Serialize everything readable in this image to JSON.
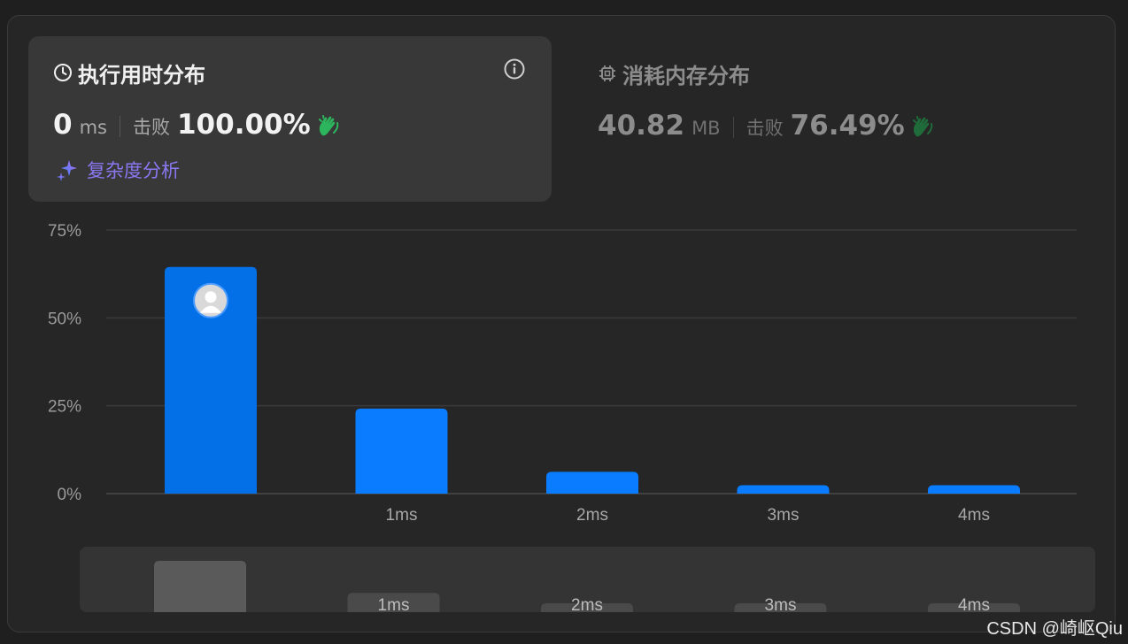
{
  "runtime": {
    "title": "执行用时分布",
    "value": "0",
    "unit": "ms",
    "beat_label": "击败",
    "beat_value": "100.00%",
    "analysis_label": "复杂度分析"
  },
  "memory": {
    "title": "消耗内存分布",
    "value": "40.82",
    "unit": "MB",
    "beat_label": "击败",
    "beat_value": "76.49%"
  },
  "chart_data": {
    "type": "bar",
    "categories": [
      "0ms",
      "1ms",
      "2ms",
      "3ms",
      "4ms"
    ],
    "category_labels": [
      "",
      "1ms",
      "2ms",
      "3ms",
      "4ms"
    ],
    "values": [
      64.5,
      24.2,
      6.2,
      2.4,
      2.4
    ],
    "highlighted_index": 0,
    "yticks": [
      "0%",
      "25%",
      "50%",
      "75%"
    ],
    "ytick_values": [
      0,
      25,
      50,
      75
    ],
    "ylim": [
      0,
      75
    ],
    "grid": true,
    "title": "",
    "xlabel": "",
    "ylabel": ""
  },
  "overview": {
    "labels": [
      "",
      "1ms",
      "2ms",
      "3ms",
      "4ms"
    ]
  },
  "colors": {
    "bar": "#0a7cff",
    "bar_highlight": "#0470e8",
    "clap": "#2db55d",
    "clap_dim": "#1f6b3a",
    "analysis": "#8a78f2"
  },
  "watermark": "CSDN @崎岖Qiu"
}
